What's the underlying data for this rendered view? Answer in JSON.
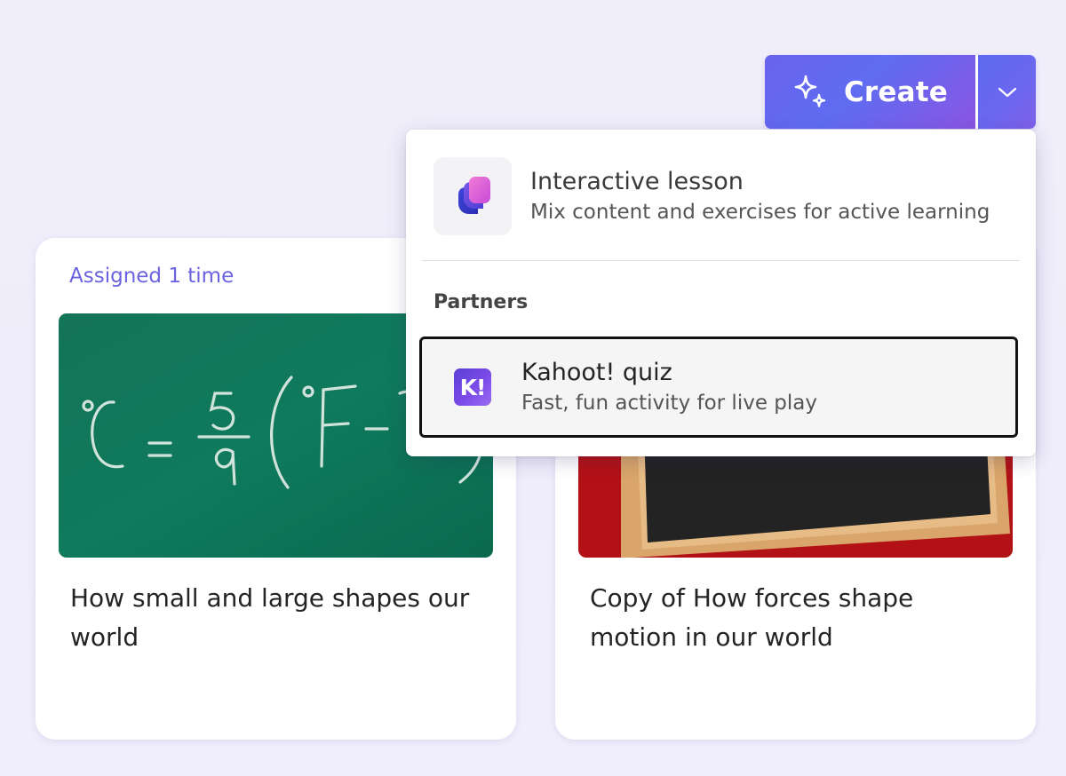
{
  "create_button": {
    "label": "Create",
    "icon": "sparkle-icon",
    "dropdown_icon": "chevron-down-icon"
  },
  "cards": [
    {
      "badge": "Assigned 1 time",
      "image": "chalkboard-temperature-formula",
      "image_text": "°C = 5/9 (°F-3",
      "title": "How small and large shapes our world"
    },
    {
      "badge": "",
      "image": "blackboard-wood-frame",
      "title": "Copy of How forces shape motion in our world"
    }
  ],
  "menu": {
    "items": [
      {
        "icon": "interactive-lesson-icon",
        "title": "Interactive lesson",
        "subtitle": "Mix content and exercises for active learning"
      }
    ],
    "partners_label": "Partners",
    "partner_items": [
      {
        "icon": "kahoot-logo-icon",
        "logo_text": "K!",
        "title": "Kahoot! quiz",
        "subtitle": "Fast, fun activity for live play",
        "focused": true
      }
    ]
  },
  "colors": {
    "accent": "#6b63df",
    "button_gradient_start": "#6a63ee",
    "button_gradient_end": "#8a55e3",
    "chalkboard_green": "#10765a",
    "background": "#f1eefb"
  }
}
